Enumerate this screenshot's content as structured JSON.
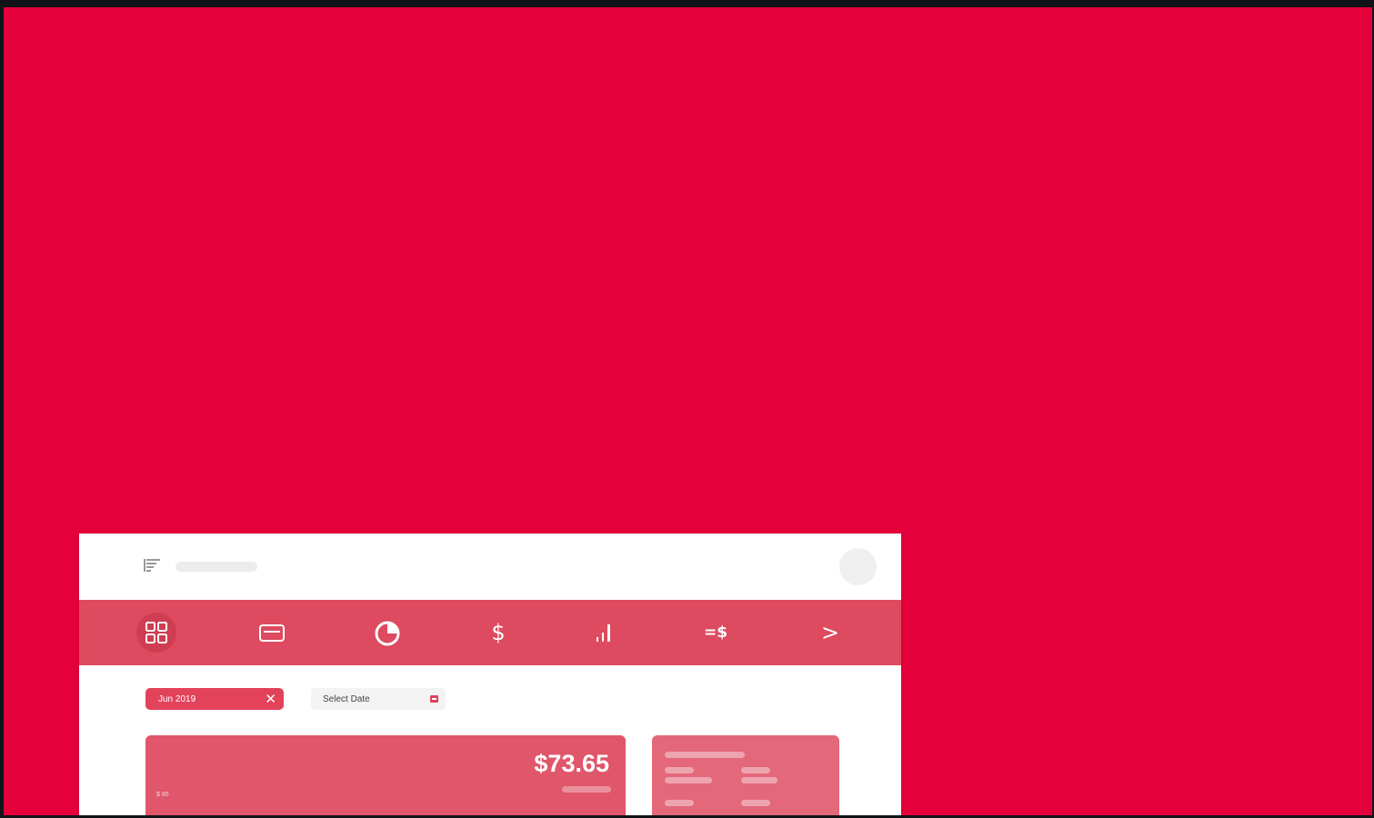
{
  "nav": {
    "items": [
      {
        "name": "dashboard",
        "icon": "grid-icon",
        "active": true
      },
      {
        "name": "cards",
        "icon": "card-icon"
      },
      {
        "name": "reports",
        "icon": "pie-chart-icon"
      },
      {
        "name": "payments",
        "icon": "dollar-icon",
        "text": "$"
      },
      {
        "name": "statistics",
        "icon": "bar-chart-icon"
      },
      {
        "name": "exchange",
        "icon": "exchange-dollar-icon",
        "text": "=$"
      },
      {
        "name": "more",
        "icon": "chevron-right-icon",
        "text": ">"
      }
    ]
  },
  "filters": {
    "chip_label": "Jun 2019",
    "chip_close": "✕",
    "date_picker_label": "Select Date"
  },
  "summary_card": {
    "amount": "$73.65",
    "small_label": "$ 85"
  },
  "colors": {
    "background": "#e4003b",
    "navbar": "#de4a5f",
    "accent": "#e2425a"
  }
}
